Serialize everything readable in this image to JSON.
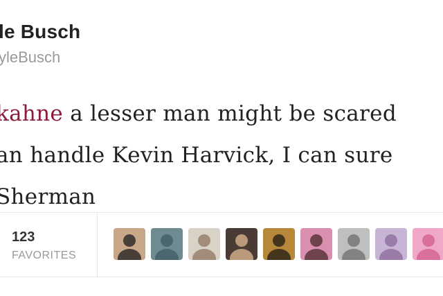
{
  "tweet": {
    "display_name": "le Busch",
    "handle": "yleBusch",
    "text_lines": [
      {
        "mention": "kahne",
        "rest": " a lesser man might be scared"
      },
      {
        "mention": "",
        "rest": "an handle Kevin Harvick, I can sure"
      },
      {
        "mention": "",
        "rest": "Sherman"
      }
    ],
    "mention_color": "#8b1c3c"
  },
  "stats": {
    "favorites_count": "123",
    "favorites_label": "FAVORITES"
  },
  "favoriters": [
    {
      "name": "favoriter-avatar-1",
      "bg": "#c9a88a",
      "fg": "#1c1c1c"
    },
    {
      "name": "favoriter-avatar-2",
      "bg": "#6f8b92",
      "fg": "#3d5961"
    },
    {
      "name": "favoriter-avatar-3",
      "bg": "#d9d2c6",
      "fg": "#8f7560"
    },
    {
      "name": "favoriter-avatar-4",
      "bg": "#4a3c34",
      "fg": "#e2b993"
    },
    {
      "name": "favoriter-avatar-5",
      "bg": "#b8883a",
      "fg": "#1f1a14"
    },
    {
      "name": "favoriter-avatar-6",
      "bg": "#d98fb0",
      "fg": "#4a2a2a"
    },
    {
      "name": "favoriter-avatar-7",
      "bg": "#bfbfbf",
      "fg": "#6e6e6e"
    },
    {
      "name": "favoriter-avatar-8",
      "bg": "#c8b5d6",
      "fg": "#8a6a9a"
    },
    {
      "name": "favoriter-avatar-9",
      "bg": "#f0a8c8",
      "fg": "#d15c8e"
    }
  ]
}
